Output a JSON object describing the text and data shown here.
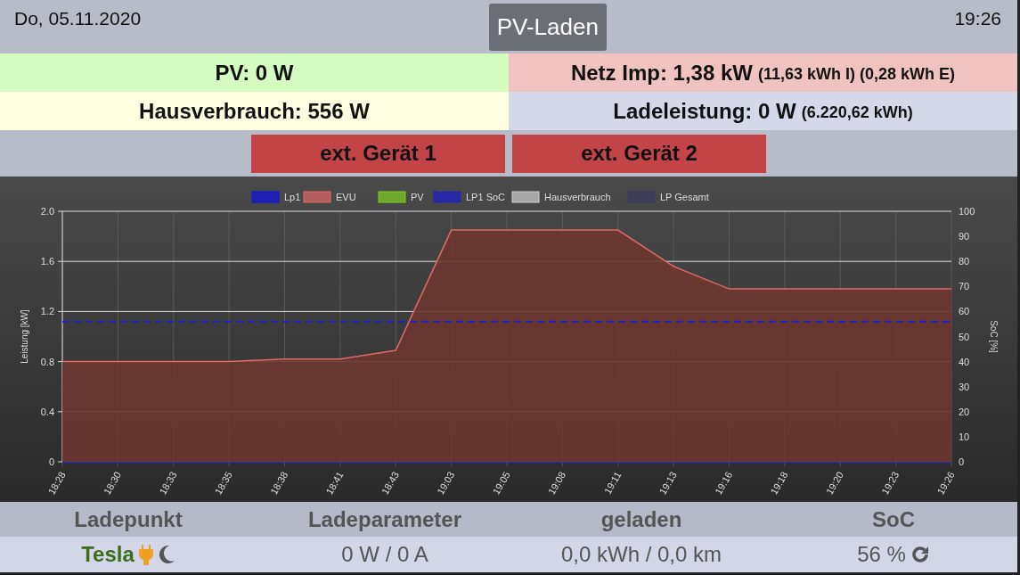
{
  "header": {
    "date": "Do, 05.11.2020",
    "mode_button": "PV-Laden",
    "time": "19:26"
  },
  "tiles": [
    {
      "text": "PV: 0 W",
      "color": "#d4fcc0"
    },
    {
      "text": "Netz Imp: 1,38 kW",
      "detail": "(11,63 kWh I) (0,28 kWh E)",
      "color": "#f0c3c0"
    },
    {
      "text": "Hausverbrauch: 556 W",
      "color": "#fefee0"
    },
    {
      "text": "Ladeleistung: 0 W",
      "detail": "(6.220,62 kWh)",
      "color": "#d5d8e8"
    }
  ],
  "devices": [
    {
      "label": "ext. Gerät 1",
      "on": false
    },
    {
      "label": "ext. Gerät 2",
      "on": false
    }
  ],
  "chart_data": {
    "type": "area",
    "grid": true,
    "legend": "top",
    "ylabel": "Leistung [kW]",
    "y2label": "SoC [%]",
    "categories": [
      "18:28",
      "18:30",
      "18:33",
      "18:35",
      "18:38",
      "18:41",
      "18:43",
      "19:03",
      "19:05",
      "19:08",
      "19:11",
      "19:13",
      "19:16",
      "19:18",
      "19:20",
      "19:23",
      "19:26"
    ],
    "series": [
      {
        "name": "Lp1",
        "color": "#1010e0",
        "type": "line",
        "values": [
          0,
          0,
          0,
          0,
          0,
          0,
          0,
          0,
          0,
          0,
          0,
          0,
          0,
          0,
          0,
          0,
          0
        ]
      },
      {
        "name": "EVU",
        "color": "#e06a66",
        "values": [
          0.8,
          0.8,
          0.8,
          0.8,
          0.82,
          0.82,
          0.89,
          1.85,
          1.85,
          1.85,
          1.85,
          1.56,
          1.38,
          1.38,
          1.38,
          1.38,
          1.38
        ]
      },
      {
        "name": "PV",
        "color": "#7fd020",
        "values": [
          null,
          null,
          null,
          null,
          null,
          null,
          null,
          null,
          null,
          null,
          null,
          null,
          null,
          null,
          null,
          null,
          null
        ]
      },
      {
        "name": "LP1 SoC",
        "color": "#2020c0",
        "axis": "y2",
        "type": "line",
        "line_style": "dashed",
        "values": [
          56,
          56,
          56,
          56,
          56,
          56,
          56,
          56,
          56,
          56,
          56,
          56,
          56,
          56,
          56,
          56,
          56
        ]
      },
      {
        "name": "Hausverbrauch",
        "color": "#d0d0d0",
        "values": [
          null,
          null,
          null,
          null,
          null,
          null,
          null,
          null,
          null,
          null,
          null,
          null,
          null,
          null,
          null,
          null,
          null
        ]
      },
      {
        "name": "LP Gesamt",
        "color": "#3a3a60",
        "values": [
          null,
          null,
          null,
          null,
          null,
          null,
          null,
          null,
          null,
          null,
          null,
          null,
          null,
          null,
          null,
          null,
          null
        ]
      }
    ],
    "ylim": [
      0,
      2
    ],
    "yticks": [
      {
        "value": 0,
        "label": "0"
      },
      {
        "value": 0.4,
        "label": "0.4"
      },
      {
        "value": 0.8,
        "label": "0.8"
      },
      {
        "value": 1.2,
        "label": "1.2"
      },
      {
        "value": 1.6,
        "label": "1.6"
      },
      {
        "value": 2,
        "label": "2.0"
      }
    ],
    "y2lim": [
      0,
      100
    ],
    "y2ticks": [
      0,
      10,
      20,
      30,
      40,
      50,
      60,
      70,
      80,
      90,
      100
    ]
  },
  "table": {
    "columns": [
      "Ladepunkt",
      "Ladeparameter",
      "geladen",
      "SoC"
    ],
    "rows": [
      {
        "name": "Tesla",
        "plugged": true,
        "night_charging": true,
        "parameters": "0 W / 0 A",
        "charged": "0,0 kWh / 0,0 km",
        "soc": "56 %"
      }
    ]
  }
}
